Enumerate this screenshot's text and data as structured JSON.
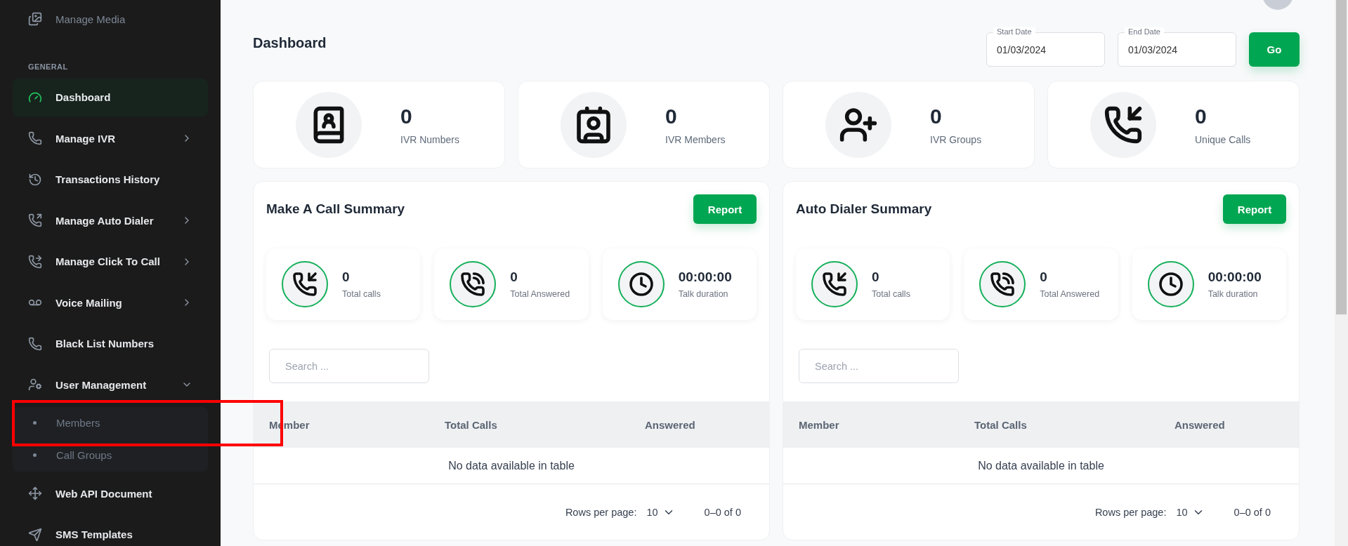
{
  "sidebar": {
    "top_items": [
      {
        "label": "Manage Media"
      }
    ],
    "section_title": "GENERAL",
    "items": [
      {
        "label": "Dashboard",
        "selected": true
      },
      {
        "label": "Manage IVR",
        "selected": false,
        "expanded": false
      },
      {
        "label": "Transactions History",
        "selected": false
      },
      {
        "label": "Manage Auto Dialer",
        "selected": false,
        "expanded": false
      },
      {
        "label": "Manage Click To Call",
        "selected": false,
        "expanded": false
      },
      {
        "label": "Voice Mailing",
        "selected": false,
        "expanded": false
      },
      {
        "label": "Black List Numbers",
        "selected": false
      },
      {
        "label": "User Management",
        "selected": false,
        "expanded": true,
        "children": [
          {
            "label": "Members",
            "selected": false
          },
          {
            "label": "Call Groups",
            "selected": false
          }
        ]
      },
      {
        "label": "Web API Document",
        "selected": false
      },
      {
        "label": "SMS Templates",
        "selected": false
      }
    ]
  },
  "header": {
    "title": "Dashboard",
    "date_filters": [
      {
        "label": "Start Date",
        "value": "01/03/2024"
      },
      {
        "label": "End Date",
        "value": "01/03/2024"
      }
    ],
    "go_button": "Go"
  },
  "stats": [
    {
      "value": "0",
      "label": "IVR Numbers"
    },
    {
      "value": "0",
      "label": "IVR Members"
    },
    {
      "value": "0",
      "label": "IVR Groups"
    },
    {
      "value": "0",
      "label": "Unique Calls"
    }
  ],
  "summaries": [
    {
      "title": "Make A Call Summary",
      "button": "Report",
      "metrics": [
        {
          "value": "0",
          "label": "Total calls"
        },
        {
          "value": "0",
          "label": "Total Answered"
        },
        {
          "value": "00:00:00",
          "label": "Talk duration"
        }
      ],
      "search": {
        "placeholder": "Search ..."
      },
      "table": {
        "columns": [
          "Member",
          "Total Calls",
          "Answered"
        ],
        "empty_message": "No data available in table"
      },
      "pagination": {
        "rows_label": "Rows per page:",
        "rows_value": "10",
        "range": "0–0 of 0"
      }
    },
    {
      "title": "Auto Dialer Summary",
      "button": "Report",
      "metrics": [
        {
          "value": "0",
          "label": "Total calls"
        },
        {
          "value": "0",
          "label": "Total Answered"
        },
        {
          "value": "00:00:00",
          "label": "Talk duration"
        }
      ],
      "search": {
        "placeholder": "Search ..."
      },
      "table": {
        "columns": [
          "Member",
          "Total Calls",
          "Answered"
        ],
        "empty_message": "No data available in table"
      },
      "pagination": {
        "rows_label": "Rows per page:",
        "rows_value": "10",
        "range": "0–0 of 0"
      }
    }
  ],
  "annotation": {
    "kind": "frame"
  }
}
